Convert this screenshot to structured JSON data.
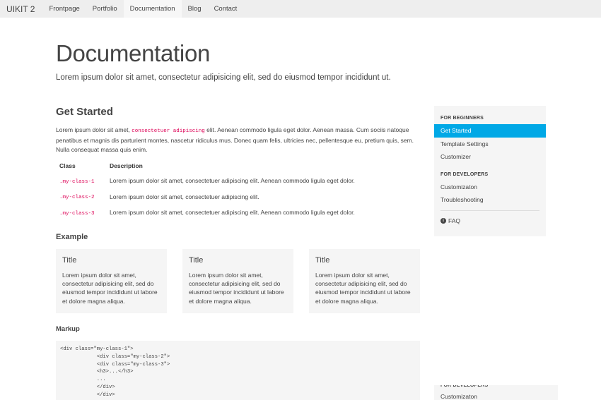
{
  "navbar": {
    "brand": "UIKIT 2",
    "items": [
      {
        "label": "Frontpage"
      },
      {
        "label": "Portfolio"
      },
      {
        "label": "Documentation"
      },
      {
        "label": "Blog"
      },
      {
        "label": "Contact"
      }
    ],
    "active": "Documentation"
  },
  "page": {
    "title": "Documentation",
    "lead": "Lorem ipsum dolor sit amet, consectetur adipisicing elit, sed do eiusmod tempor incididunt ut."
  },
  "get_started": {
    "title": "Get Started",
    "intro_before": "Lorem ipsum dolor sit amet, ",
    "intro_code": "consectetuer adipiscing",
    "intro_after": " elit. Aenean commodo ligula eget dolor. Aenean massa. Cum sociis natoque penatibus et magnis dis parturient montes, nascetur ridiculus mus. Donec quam felis, ultricies nec, pellentesque eu, pretium quis, sem. Nulla consequat massa quis enim."
  },
  "table": {
    "headers": {
      "class": "Class",
      "description": "Description"
    },
    "rows": [
      {
        "class": ".my-class-1",
        "description": "Lorem ipsum dolor sit amet, consectetuer adipiscing elit. Aenean commodo ligula eget dolor."
      },
      {
        "class": ".my-class-2",
        "description": "Lorem ipsum dolor sit amet, consectetuer adipiscing elit."
      },
      {
        "class": ".my-class-3",
        "description": "Lorem ipsum dolor sit amet, consectetuer adipiscing elit. Aenean commodo ligula eget dolor."
      }
    ]
  },
  "example": {
    "title": "Example",
    "panels": [
      {
        "title": "Title",
        "text": "Lorem ipsum dolor sit amet, consectetur adipisicing elit, sed do eiusmod tempor incididunt ut labore et dolore magna aliqua."
      },
      {
        "title": "Title",
        "text": "Lorem ipsum dolor sit amet, consectetur adipisicing elit, sed do eiusmod tempor incididunt ut labore et dolore magna aliqua."
      },
      {
        "title": "Title",
        "text": "Lorem ipsum dolor sit amet, consectetur adipisicing elit, sed do eiusmod tempor incididunt ut labore et dolore magna aliqua."
      }
    ]
  },
  "markup": {
    "title": "Markup",
    "lines": [
      "<div class=\"my-class-1\">",
      "            <div class=\"my-class-2\">",
      "            <div class=\"my-class-3\">",
      "            <h3>...</h3>",
      "            ...",
      "            </div>",
      "            </div>"
    ]
  },
  "sidebar": {
    "beginners_header": "FOR BEGINNERS",
    "beginners_items": [
      {
        "label": "Get Started"
      },
      {
        "label": "Template Settings"
      },
      {
        "label": "Customizer"
      }
    ],
    "developers_header": "FOR DEVELOPERS",
    "developers_items": [
      {
        "label": "Customizaton"
      },
      {
        "label": "Troubleshooting"
      }
    ],
    "faq_label": "FAQ",
    "active": "Get Started",
    "accent_color": "#00a8e6"
  },
  "sidebar_sticky": {
    "header": "FOR DEVELOPERS",
    "item": "Customizaton"
  }
}
